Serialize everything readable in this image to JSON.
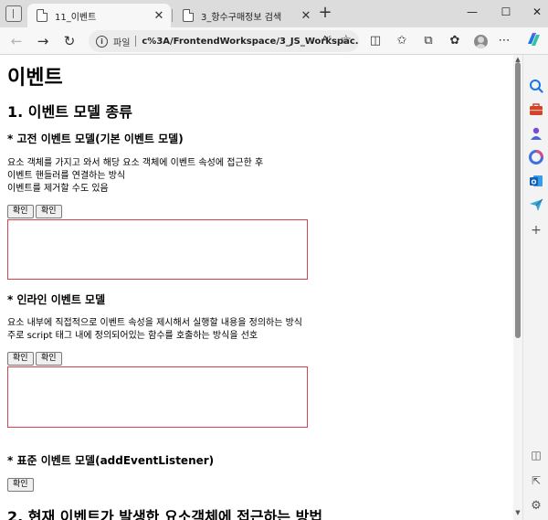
{
  "browser": {
    "tabs": [
      {
        "title": "11_이벤트",
        "active": true
      },
      {
        "title": "3_항수구매정보 검색",
        "active": false
      }
    ],
    "new_tab_label": "+",
    "address": {
      "scheme_label": "파일",
      "url": "c%3A/FrontendWorkspace/3_JS_Workspac...",
      "reader_label": "Aˢ"
    },
    "window_controls": {
      "minimize": "—",
      "maximize": "☐",
      "close": "✕"
    }
  },
  "page": {
    "title": "이벤트",
    "section1": {
      "heading": "1. 이벤트 모델 종류",
      "classic": {
        "heading": "* 고전 이벤트 모델(기본 이벤트 모델)",
        "lines": [
          "요소 객체를 가지고 와서 해당 요소 객체에 이벤트 속성에 접근한 후",
          "이벤트 핸들러를 연결하는 방식",
          "이벤트를 제거할 수도 있음"
        ],
        "buttons": [
          "확인",
          "확인"
        ]
      },
      "inline": {
        "heading": "* 인라인 이벤트 모델",
        "lines": [
          "요소 내부에 직접적으로 이벤트 속성을 제시해서 실행할 내용을 정의하는 방식",
          "주로 script 태그 내에 정의되어있는 함수를 호출하는 방식을 선호"
        ],
        "buttons": [
          "확인",
          "확인"
        ]
      },
      "standard": {
        "heading": "* 표준 이벤트 모델(addEventListener)",
        "buttons": [
          "확인"
        ]
      }
    },
    "section2": {
      "heading": "2. 현재 이벤트가 발생한 요소객체에 접근하는 방법"
    }
  },
  "colors": {
    "box_border": "#d8404c",
    "page_bg": "#ffffff",
    "chrome_bg": "#f3f3f3"
  }
}
